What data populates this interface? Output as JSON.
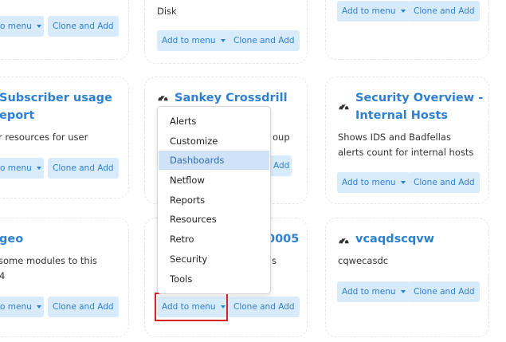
{
  "cards": {
    "a1": {
      "desc": "Disk"
    },
    "a2": {},
    "a3": {},
    "b1": {
      "title_l1": "Subscriber usage",
      "title_l2": "eport",
      "desc": "r resources for user"
    },
    "b2": {
      "title": "Sankey Crossdrill",
      "desc_frag": "oup"
    },
    "b3": {
      "title_l1": "Security Overview -",
      "title_l2": "Internal Hosts",
      "desc_l1": "Shows IDS and Badfellas",
      "desc_l2": "alerts count for internal hosts"
    },
    "c1": {
      "title": "geo",
      "desc_l1": "some modules to this",
      "desc_l2": "4"
    },
    "c2": {
      "title_frag": "0005",
      "desc_frag": "s"
    },
    "c3": {
      "title": "vcaqdscqvw",
      "desc": "cqwecasdc"
    }
  },
  "buttons": {
    "add_to_menu": "Add to menu",
    "add_to_menu_cut": "o menu",
    "clone_and_add": "Clone and Add",
    "clone_cut": "Clone and Add"
  },
  "dropdown": {
    "items": [
      "Alerts",
      "Customize",
      "Dashboards",
      "Netflow",
      "Reports",
      "Resources",
      "Retro",
      "Security",
      "Tools"
    ],
    "active": "Dashboards"
  },
  "colors": {
    "accent": "#2f80d1",
    "button_bg": "#d8ebfb",
    "highlight": "#e02020"
  },
  "icons": {
    "card_icon": "dashboard-gauge-icon"
  }
}
